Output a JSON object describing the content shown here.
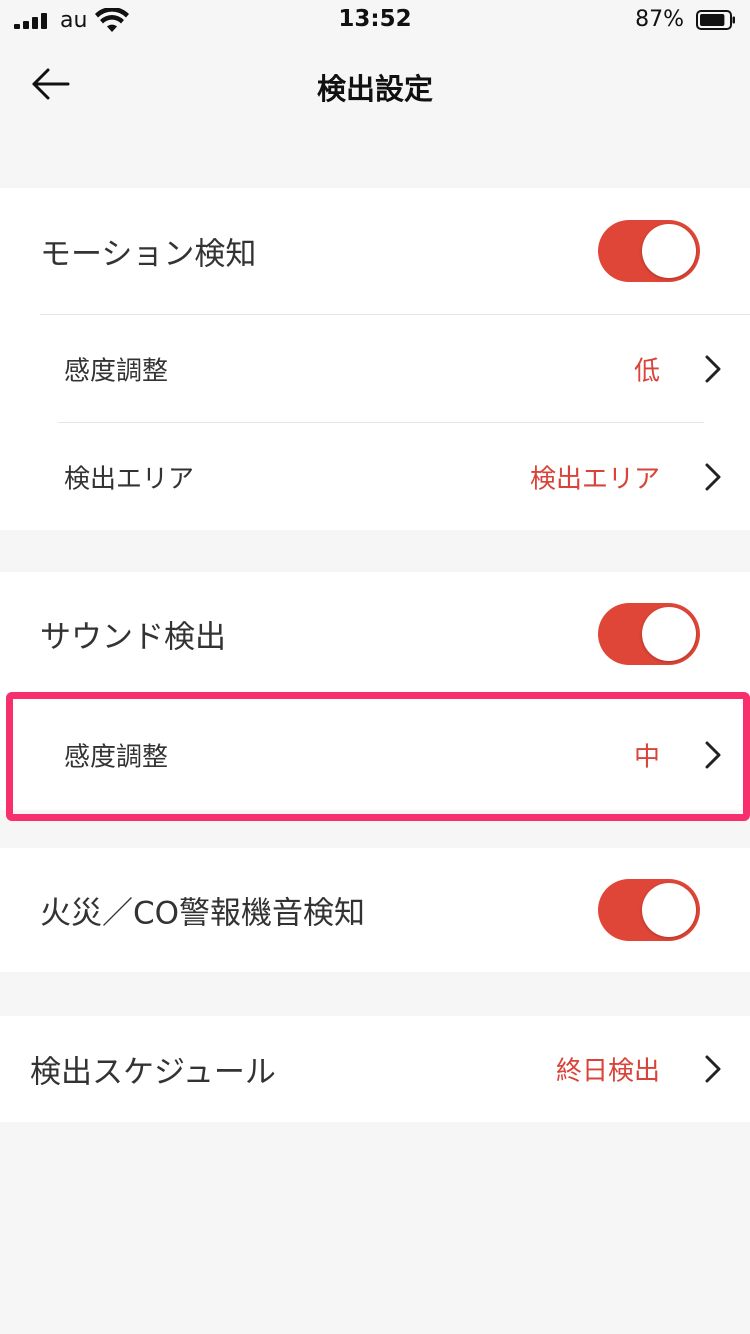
{
  "status_bar": {
    "carrier": "au",
    "time": "13:52",
    "battery_percent": "87%",
    "battery_level": 0.87,
    "icons": [
      "signal-icon",
      "wifi-icon",
      "battery-icon"
    ]
  },
  "nav": {
    "title": "検出設定",
    "back_icon": "arrow-left-icon"
  },
  "colors": {
    "accent": "#e04637",
    "value_text": "#d9443a",
    "highlight": "#f72f6d",
    "background": "#f6f6f6"
  },
  "motion": {
    "label": "モーション検知",
    "enabled": true,
    "sensitivity": {
      "label": "感度調整",
      "value": "低"
    },
    "area": {
      "label": "検出エリア",
      "value": "検出エリア"
    }
  },
  "sound": {
    "label": "サウンド検出",
    "enabled": true,
    "sensitivity": {
      "label": "感度調整",
      "value": "中"
    }
  },
  "alarm": {
    "label": "火災／CO警報機音検知",
    "enabled": true
  },
  "schedule": {
    "label": "検出スケジュール",
    "value": "終日検出"
  }
}
